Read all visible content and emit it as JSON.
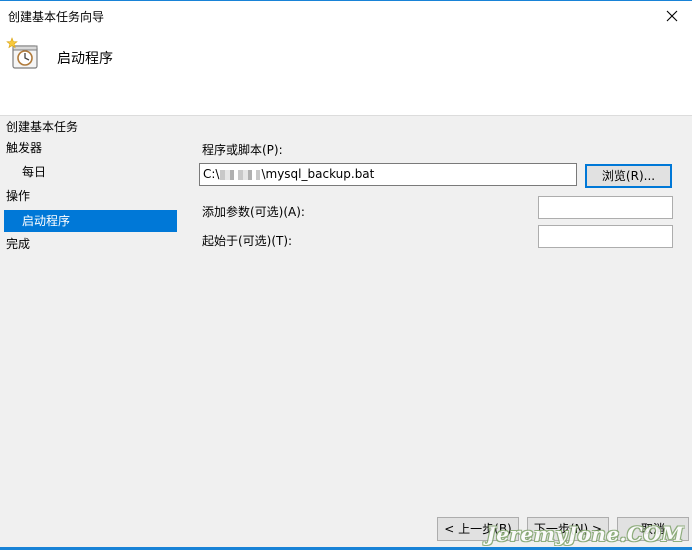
{
  "window": {
    "title": "创建基本任务向导"
  },
  "header": {
    "title": "启动程序"
  },
  "steps": {
    "title": "创建基本任务",
    "items": [
      {
        "label": "触发器"
      },
      {
        "label": "每日"
      },
      {
        "label": "操作"
      },
      {
        "label": "启动程序"
      },
      {
        "label": "完成"
      }
    ]
  },
  "form": {
    "program_label": "程序或脚本(P):",
    "program_value_prefix": "C:\\",
    "program_value_suffix": "\\mysql_backup.bat",
    "browse_label": "浏览(R)...",
    "args_label": "添加参数(可选)(A):",
    "args_value": "",
    "start_label": "起始于(可选)(T):",
    "start_value": ""
  },
  "footer": {
    "back_label": "< 上一步(B)",
    "next_label": "下一步(N) >",
    "cancel_label": "取消"
  },
  "watermark": "JeremyJone.COM",
  "colors": {
    "accent": "#0078d7",
    "titlebar_border": "#1883d7"
  }
}
